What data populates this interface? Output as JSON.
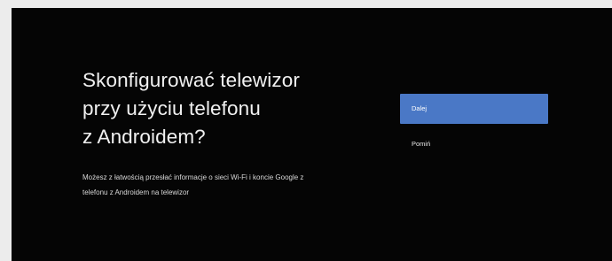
{
  "setup": {
    "title_lines": [
      "Skonfigurować telewizor",
      "przy użyciu telefonu",
      "z Androidem?"
    ],
    "description_lines": [
      "Możesz z łatwością przesłać informacje o sieci Wi-Fi i koncie Google z",
      "telefonu z Androidem na telewizor"
    ]
  },
  "options": {
    "primary_label": "Dalej",
    "secondary_label": "Pomiń"
  },
  "colors": {
    "background": "#050505",
    "accent": "#4a78c6",
    "frame": "#ececec"
  }
}
